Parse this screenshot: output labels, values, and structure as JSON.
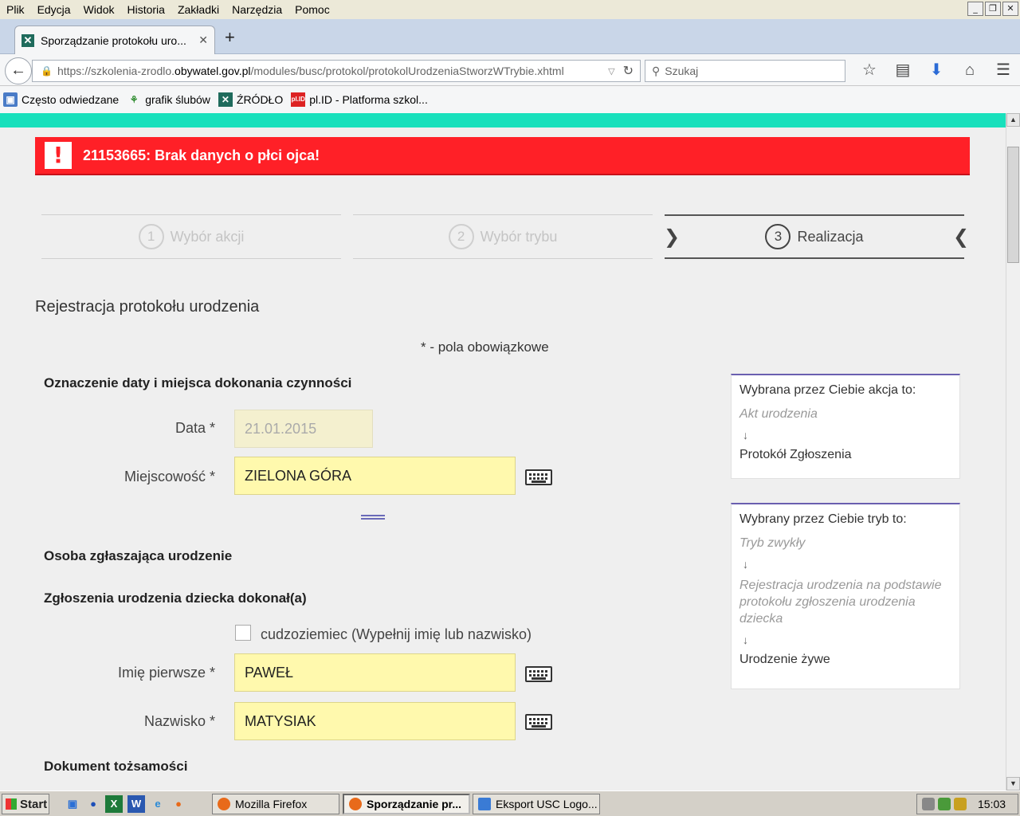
{
  "menu": [
    "Plik",
    "Edycja",
    "Widok",
    "Historia",
    "Zakładki",
    "Narzędzia",
    "Pomoc"
  ],
  "window_controls": [
    "_",
    "❐",
    "✕"
  ],
  "tab": {
    "title": "Sporządzanie protokołu uro...",
    "close": "✕"
  },
  "new_tab": "+",
  "urlbar": {
    "prefix": "https://szkolenia-zrodlo.",
    "domain": "obywatel.gov.pl",
    "suffix": "/modules/busc/protokol/protokolUrodzeniaStworzWTrybie.xhtml"
  },
  "search": {
    "placeholder": "Szukaj"
  },
  "bookmarks": [
    "Często odwiedzane",
    "grafik ślubów",
    "ŹRÓDŁO",
    "pl.ID - Platforma szkol..."
  ],
  "error": {
    "message": "21153665: Brak danych o płci ojca!"
  },
  "steps": [
    {
      "num": "1",
      "label": "Wybór akcji"
    },
    {
      "num": "2",
      "label": "Wybór trybu"
    },
    {
      "num": "3",
      "label": "Realizacja"
    }
  ],
  "page_title": "Rejestracja protokołu urodzenia",
  "required_note": "* - pola obowiązkowe",
  "section_date": "Oznaczenie daty i miejsca dokonania czynności",
  "fields": {
    "data": {
      "label": "Data *",
      "value": "21.01.2015"
    },
    "miejscowosc": {
      "label": "Miejscowość *",
      "value": "ZIELONA GÓRA"
    },
    "imie": {
      "label": "Imię pierwsze *",
      "value": "PAWEŁ"
    },
    "nazwisko": {
      "label": "Nazwisko *",
      "value": "MATYSIAK"
    }
  },
  "section_person": "Osoba zgłaszająca urodzenie",
  "section_reported": "Zgłoszenia urodzenia dziecka dokonał(a)",
  "foreigner_checkbox": "cudzoziemiec (Wypełnij imię lub nazwisko)",
  "section_document": "Dokument tożsamości",
  "panel_action": {
    "heading": "Wybrana przez Ciebie akcja to:",
    "item": "Akt urodzenia",
    "arrow": "↓",
    "result": "Protokół Zgłoszenia"
  },
  "panel_mode": {
    "heading": "Wybrany przez Ciebie tryb to:",
    "item1": "Tryb zwykły",
    "item2": "Rejestracja urodzenia na podstawie protokołu zgłoszenia urodzenia dziecka",
    "arrow": "↓",
    "result": "Urodzenie żywe"
  },
  "taskbar": {
    "start": "Start",
    "windows": [
      "Mozilla Firefox",
      "Sporządzanie pr...",
      "Eksport USC Logo..."
    ],
    "clock": "15:03"
  }
}
